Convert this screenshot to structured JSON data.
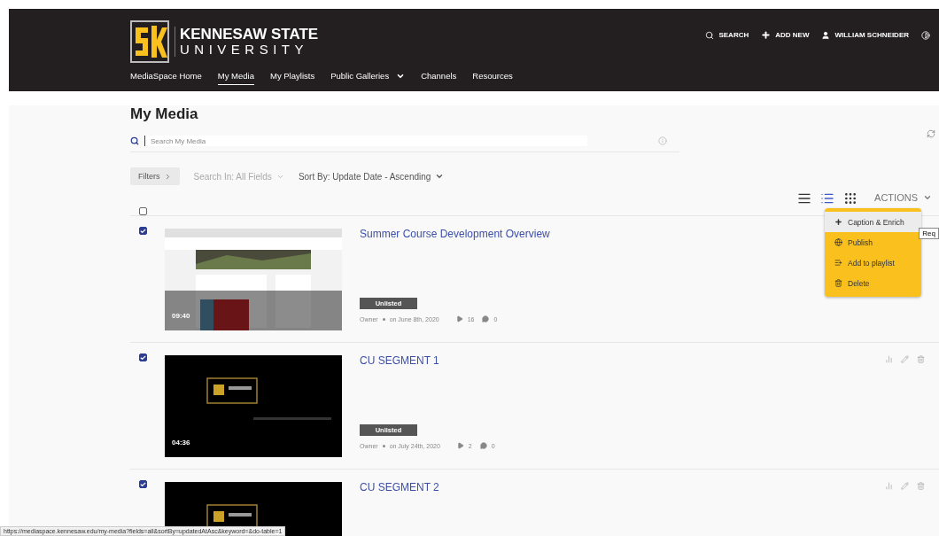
{
  "header": {
    "logo": {
      "line_1": "KENNESAW STATE",
      "line_2": "UNIVERSITY"
    },
    "nav": [
      {
        "label": "MediaSpace Home",
        "selected": false,
        "dropdown": false
      },
      {
        "label": "My Media",
        "selected": true,
        "dropdown": false
      },
      {
        "label": "My Playlists",
        "selected": false,
        "dropdown": false
      },
      {
        "label": "Public Galleries",
        "selected": false,
        "dropdown": true
      },
      {
        "label": "Channels",
        "selected": false,
        "dropdown": false
      },
      {
        "label": "Resources",
        "selected": false,
        "dropdown": false
      }
    ],
    "tools": [
      {
        "kind": "search",
        "label": "SEARCH"
      },
      {
        "kind": "add",
        "label": "ADD NEW"
      },
      {
        "kind": "user",
        "label": "WILLIAM SCHNEIDER"
      },
      {
        "kind": "contrast"
      }
    ]
  },
  "page": {
    "title": "My Media",
    "search": {
      "placeholder": "Search My Media"
    },
    "filters": "Filters",
    "search_in": "Search In: All Fields",
    "sort_by": "Sort By: Update Date - Ascending",
    "views": [
      {
        "kind": "lines",
        "selected": false
      },
      {
        "kind": "details",
        "selected": true
      },
      {
        "kind": "grid",
        "selected": false
      }
    ],
    "actions": {
      "label": "ACTIONS",
      "menu": [
        {
          "kind": "plus",
          "label": "Caption & Enrich",
          "highlighted": true
        },
        {
          "kind": "globe",
          "label": "Publish",
          "highlighted": false
        },
        {
          "kind": "playlist",
          "label": "Add to playlist",
          "highlighted": false
        },
        {
          "kind": "trash",
          "label": "Delete",
          "highlighted": false
        }
      ]
    },
    "tooltip": "Req",
    "select_all": {
      "checked": false
    }
  },
  "media": [
    {
      "checked": true,
      "title": "Summer Course Development Overview",
      "duration": "09:40",
      "status": "Unlisted",
      "owner": "Owner",
      "date": "on June 8th, 2020",
      "plays": "16",
      "comments": "0",
      "row_actions": false
    },
    {
      "checked": true,
      "title": "CU SEGMENT 1",
      "duration": "04:36",
      "status": "Unlisted",
      "owner": "Owner",
      "date": "on July 24th, 2020",
      "plays": "2",
      "comments": "0",
      "row_actions": true
    },
    {
      "checked": true,
      "title": "CU SEGMENT 2",
      "row_actions": true
    }
  ],
  "status_bar": "https://mediaspace.kennesaw.edu/my-media?fields=all&sortBy=updatedAtAsc&keyword=&do-table=1"
}
